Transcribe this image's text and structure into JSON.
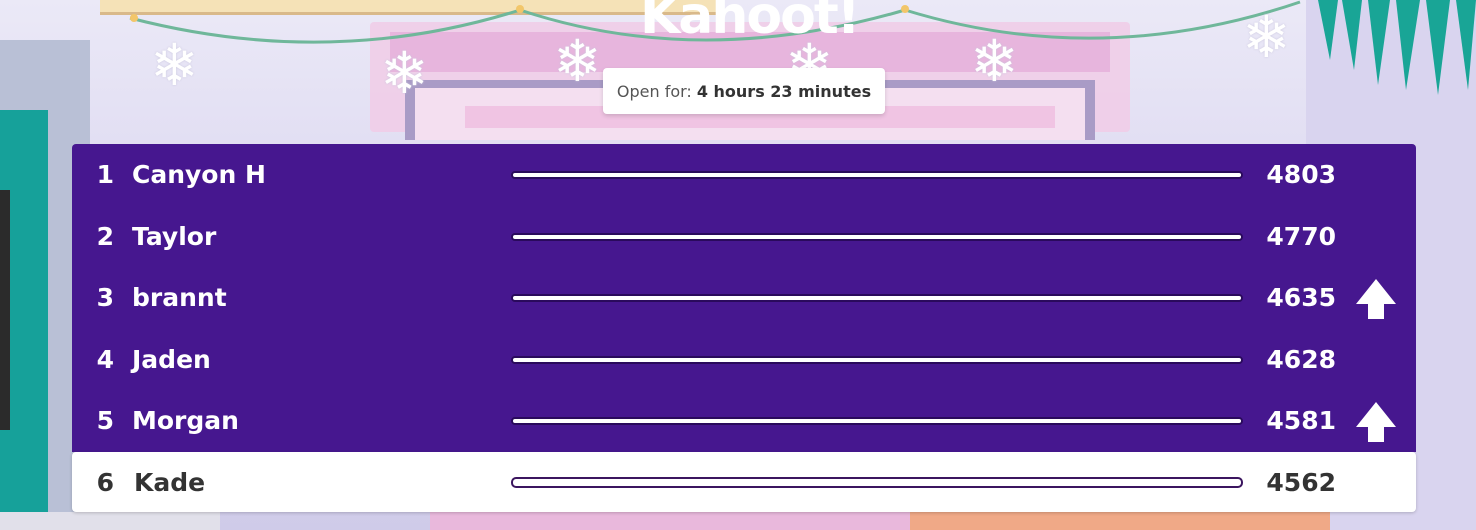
{
  "header": {
    "logo_text": "Kahoot!",
    "timer_prefix": "Open for:",
    "timer_value": "4 hours 23 minutes"
  },
  "leaderboard": {
    "rows": [
      {
        "rank": "1",
        "name": "Canyon H",
        "score": "4803",
        "progress": 1.0,
        "moved_up": false
      },
      {
        "rank": "2",
        "name": "Taylor",
        "score": "4770",
        "progress": 1.0,
        "moved_up": false
      },
      {
        "rank": "3",
        "name": "brannt",
        "score": "4635",
        "progress": 1.0,
        "moved_up": true
      },
      {
        "rank": "4",
        "name": "Jaden",
        "score": "4628",
        "progress": 1.0,
        "moved_up": false
      },
      {
        "rank": "5",
        "name": "Morgan",
        "score": "4581",
        "progress": 1.0,
        "moved_up": true
      },
      {
        "rank": "6",
        "name": "Kade",
        "score": "4562",
        "progress": 1.0,
        "moved_up": false,
        "current_player": true
      }
    ]
  },
  "icons": {
    "rank_up": "arrow-up-icon",
    "decoration": "snowflake-icon"
  },
  "colors": {
    "row_background": "#46178f",
    "highlight_row_background": "#ffffff",
    "teal_accent": "#16a19a"
  }
}
